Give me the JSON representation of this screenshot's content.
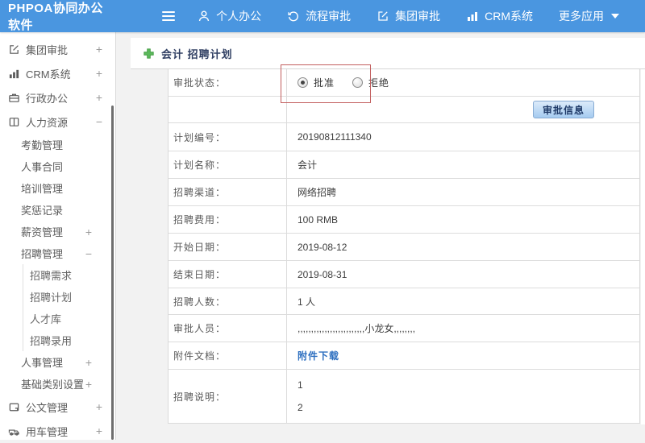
{
  "header": {
    "app_title": "PHPOA协同办公软件",
    "nav": [
      {
        "label": "个人办公",
        "icon": "user-icon"
      },
      {
        "label": "流程审批",
        "icon": "history-icon"
      },
      {
        "label": "集团审批",
        "icon": "edit-icon"
      },
      {
        "label": "CRM系统",
        "icon": "bar-chart-icon"
      },
      {
        "label": "更多应用",
        "icon": "caret-down-icon"
      }
    ]
  },
  "sidebar": {
    "items": [
      {
        "label": "集团审批",
        "level": 1,
        "icon": "edit-square-icon",
        "toggle": "+"
      },
      {
        "label": "CRM系统",
        "level": 1,
        "icon": "bar-chart-icon",
        "toggle": "+"
      },
      {
        "label": "行政办公",
        "level": 1,
        "icon": "briefcase-icon",
        "toggle": "+"
      },
      {
        "label": "人力资源",
        "level": 1,
        "icon": "book-icon",
        "toggle": "−"
      },
      {
        "label": "考勤管理",
        "level": 2
      },
      {
        "label": "人事合同",
        "level": 2
      },
      {
        "label": "培训管理",
        "level": 2
      },
      {
        "label": "奖惩记录",
        "level": 2
      },
      {
        "label": "薪资管理",
        "level": 2,
        "toggle": "+"
      },
      {
        "label": "招聘管理",
        "level": 2,
        "toggle": "−"
      },
      {
        "label": "招聘需求",
        "level": 3
      },
      {
        "label": "招聘计划",
        "level": 3
      },
      {
        "label": "人才库",
        "level": 3
      },
      {
        "label": "招聘录用",
        "level": 3
      },
      {
        "label": "人事管理",
        "level": 2,
        "toggle": "+"
      },
      {
        "label": "基础类别设置",
        "level": 2,
        "toggle": "+"
      },
      {
        "label": "公文管理",
        "level": 1,
        "icon": "document-icon",
        "toggle": "+"
      },
      {
        "label": "用车管理",
        "level": 1,
        "icon": "car-icon",
        "toggle": "+"
      }
    ]
  },
  "main": {
    "page_title": "会计 招聘计划",
    "form": {
      "status_label": "审批状态：",
      "status_options": [
        {
          "label": "批准",
          "selected": true
        },
        {
          "label": "拒绝",
          "selected": false
        }
      ],
      "approve_button": "审批信息",
      "rows": [
        {
          "label": "计划编号：",
          "value": "20190812111340"
        },
        {
          "label": "计划名称：",
          "value": "会计"
        },
        {
          "label": "招聘渠道：",
          "value": "网络招聘"
        },
        {
          "label": "招聘费用：",
          "value": "100 RMB"
        },
        {
          "label": "开始日期：",
          "value": "2019-08-12"
        },
        {
          "label": "结束日期：",
          "value": "2019-08-31"
        },
        {
          "label": "招聘人数：",
          "value": "1 人"
        },
        {
          "label": "审批人员：",
          "value": ",,,,,,,,,,,,,,,,,,,,,,,,,小龙女,,,,,,,,"
        },
        {
          "label": "附件文档：",
          "value": "附件下载"
        },
        {
          "label": "招聘说明：",
          "line1": "1",
          "line2": "2"
        }
      ]
    }
  },
  "colors": {
    "header_bg": "#4a96e0",
    "highlight_box": "#c25e5e",
    "link": "#2d6fc0",
    "button_bg": "#a5cbf0",
    "plus_icon_green": "#5cb85c"
  }
}
